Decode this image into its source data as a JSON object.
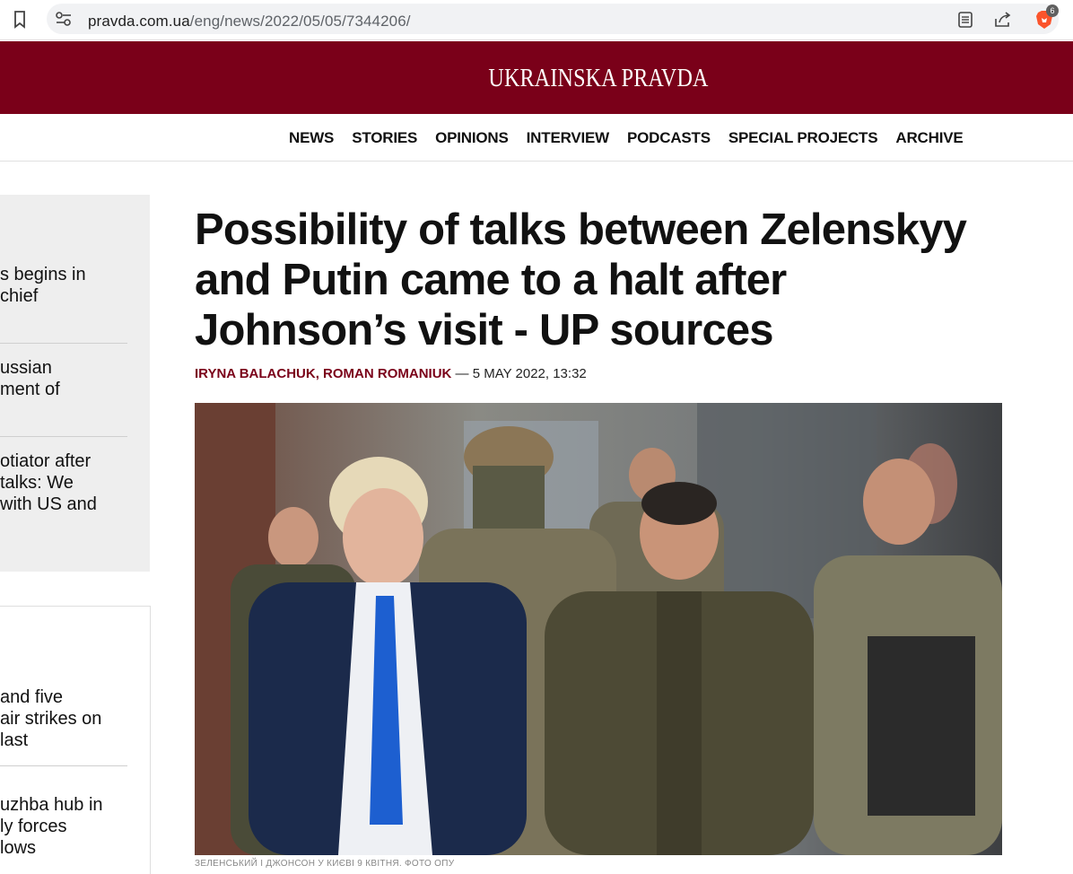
{
  "browser": {
    "url_domain": "pravda.com.ua",
    "url_path": "/eng/news/2022/05/05/7344206/",
    "brave_count": "6"
  },
  "header": {
    "logo": "UKRAINSKA PRAVDA",
    "nav": [
      "NEWS",
      "STORIES",
      "OPINIONS",
      "INTERVIEW",
      "PODCASTS",
      "SPECIAL PROJECTS",
      "ARCHIVE"
    ]
  },
  "sidebar": {
    "items": [
      {
        "lines": [
          "s begins in",
          "chief"
        ]
      },
      {
        "lines": [
          "ussian",
          "ment of"
        ]
      },
      {
        "lines": [
          "otiator after",
          " talks: We",
          "with US and"
        ]
      },
      {
        "lines": [
          "and five",
          "air strikes on",
          "last"
        ]
      },
      {
        "lines": [
          "uzhba hub in",
          "ly forces",
          "lows"
        ]
      }
    ]
  },
  "article": {
    "headline": "Possibility of talks between Zelenskyy and Putin came to a halt after Johnson’s visit - UP sources",
    "authors": "IRYNA BALACHUK, ROMAN ROMANIUK",
    "date": " — 5 MAY 2022, 13:32",
    "caption": "ЗЕЛЕНСЬКИЙ І ДЖОНСОН У КИЄВІ 9 КВІТНЯ. ФОТО ОПУ"
  },
  "colors": {
    "brand": "#7a0019"
  }
}
